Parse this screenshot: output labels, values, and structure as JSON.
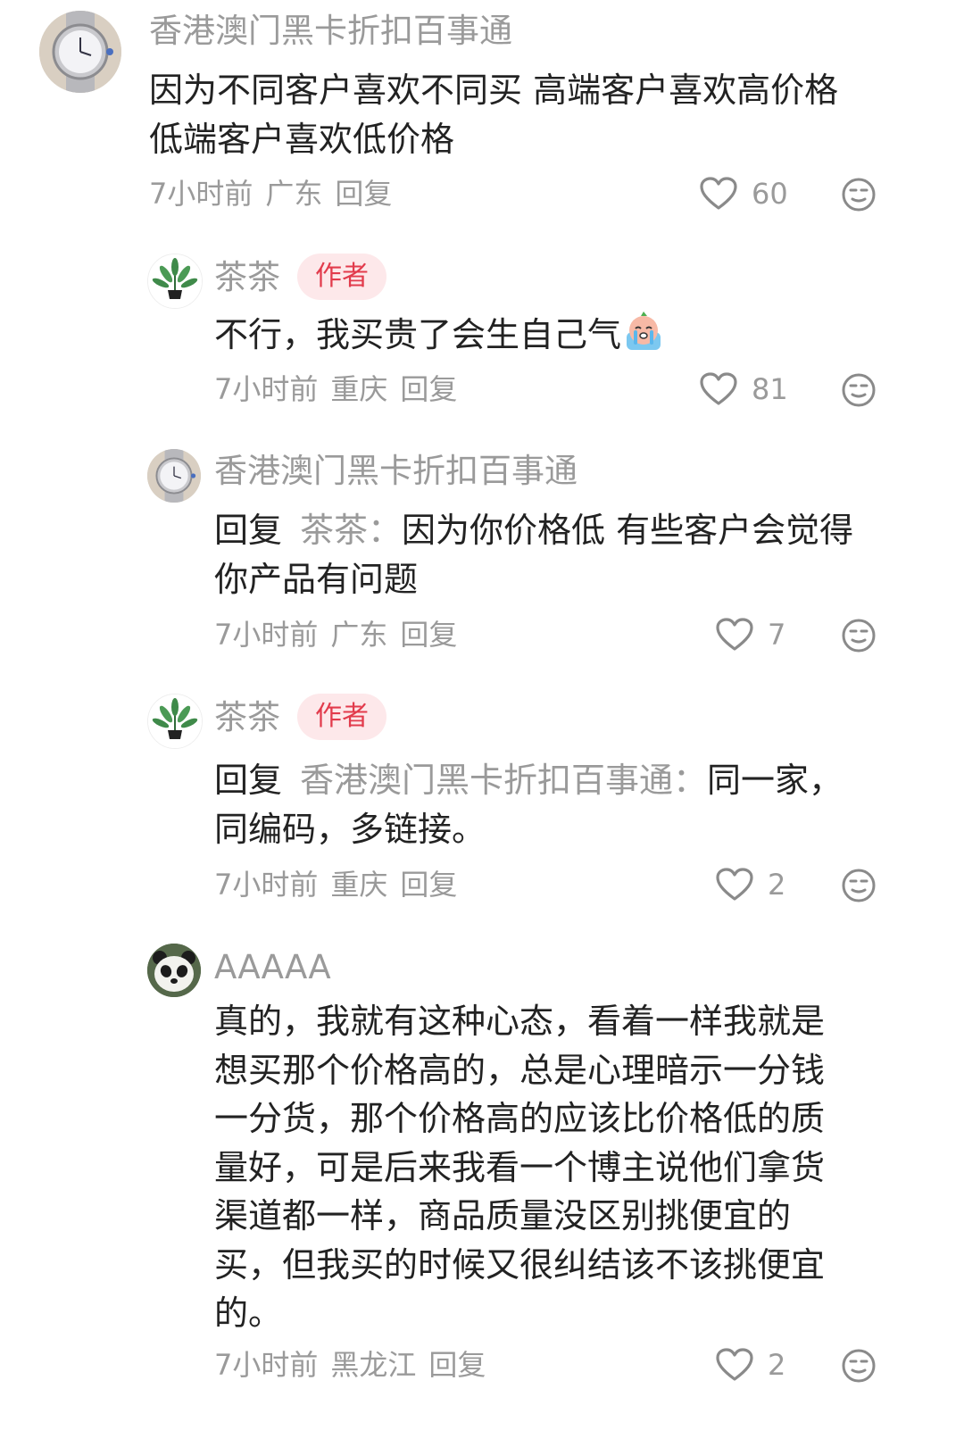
{
  "comments": [
    {
      "name": "香港澳门黑卡折扣百事通",
      "text_line1": "因为不同客户喜欢不同买 高端客户喜欢高价格",
      "text_line2": "低端客户喜欢低价格",
      "time": "7小时前",
      "location": "广东",
      "reply_label": "回复",
      "likes": "60",
      "avatar_icon": "watch-avatar"
    },
    {
      "name": "茶茶",
      "badge": "作者",
      "text_line1": "不行，我买贵了会生自己气",
      "emoji_icon": "crying-face-emoji",
      "time": "7小时前",
      "location": "重庆",
      "reply_label": "回复",
      "likes": "81",
      "avatar_icon": "plant-avatar"
    },
    {
      "name": "香港澳门黑卡折扣百事通",
      "reply_prefix": "回复",
      "reply_target": "茶茶：",
      "text_line1": "因为你价格低 有些客户会觉得",
      "text_line2": "你产品有问题",
      "time": "7小时前",
      "location": "广东",
      "reply_label": "回复",
      "likes": "7",
      "avatar_icon": "watch-avatar"
    },
    {
      "name": "茶茶",
      "badge": "作者",
      "reply_prefix": "回复",
      "reply_target": "香港澳门黑卡折扣百事通：",
      "text_line1": "同一家，",
      "text_line2": "同编码，多链接。",
      "time": "7小时前",
      "location": "重庆",
      "reply_label": "回复",
      "likes": "2",
      "avatar_icon": "plant-avatar"
    },
    {
      "name": "AAAAA",
      "lines": [
        "真的，我就有这种心态，看着一样我就是",
        "想买那个价格高的，总是心理暗示一分钱",
        "一分货，那个价格高的应该比价格低的质",
        "量好，可是后来我看一个博主说他们拿货",
        "渠道都一样，商品质量没区别挑便宜的",
        "买，但我买的时候又很纠结该不该挑便宜",
        "的。"
      ],
      "time": "7小时前",
      "location": "黑龙江",
      "reply_label": "回复",
      "likes": "2",
      "avatar_icon": "panda-avatar"
    }
  ],
  "colors": {
    "secondary_text": "#9a9a9a",
    "body_text": "#222222",
    "badge_bg": "#fde8ea",
    "badge_text": "#e23b4c"
  },
  "icons": {
    "like": "heart-outline-icon",
    "dislike": "neutral-face-icon"
  }
}
